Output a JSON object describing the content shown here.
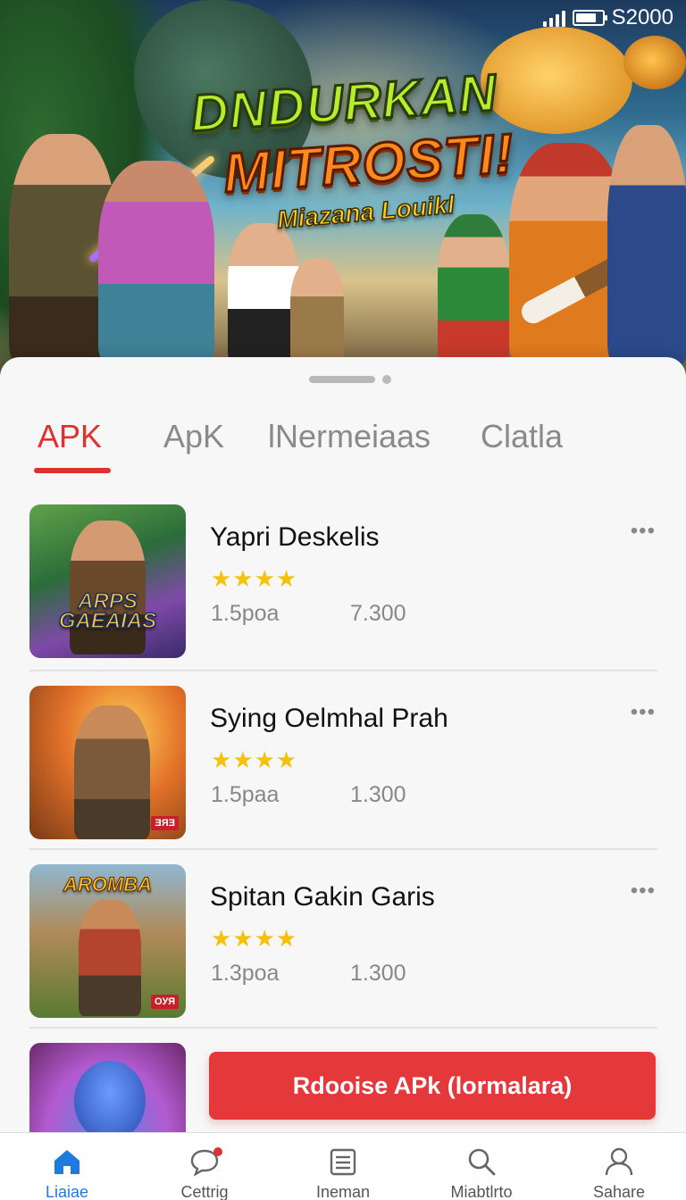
{
  "status_bar": {
    "time": "S2000"
  },
  "banner": {
    "title_line1": "DNDURKAN",
    "title_line2": "MITROSTI!",
    "subtitle": "Miazana Louikl"
  },
  "tabs": [
    {
      "label": "APK",
      "active": true
    },
    {
      "label": "ApK",
      "active": false
    },
    {
      "label": "lNermeiaas",
      "active": false
    },
    {
      "label": "Clatla",
      "active": false
    }
  ],
  "apps": [
    {
      "name": "Yapri Deskelis",
      "stars": "★★★★",
      "rating": 4,
      "size": "1.5poa",
      "count": "7.300",
      "thumb_text": "ARPS GAEAIAS",
      "thumb_badge": ""
    },
    {
      "name": "Sying Oelmhal Prah",
      "stars": "★★★★",
      "rating": 4,
      "size": "1.5paa",
      "count": "1.300",
      "thumb_text": "",
      "thumb_badge": "ƎЯƎ"
    },
    {
      "name": "Spitan Gakin Garis",
      "stars": "★★★★",
      "rating": 4,
      "size": "1.3poa",
      "count": "1.300",
      "thumb_text": "AROMBA",
      "thumb_badge": "OУЯ"
    }
  ],
  "cta_label": "Rdooise APk (lormalara)",
  "bottom_nav": [
    {
      "label": "Liaiae",
      "icon": "home-icon",
      "active": true
    },
    {
      "label": "Cettrig",
      "icon": "chat-icon",
      "active": false,
      "has_badge": true
    },
    {
      "label": "Ineman",
      "icon": "list-icon",
      "active": false
    },
    {
      "label": "Miabtlrto",
      "icon": "search-icon",
      "active": false
    },
    {
      "label": "Sahare",
      "icon": "profile-icon",
      "active": false
    }
  ],
  "colors": {
    "accent": "#e0312f",
    "nav_active": "#1d7be0",
    "star": "#f4c20d",
    "cta": "#e4383a"
  }
}
